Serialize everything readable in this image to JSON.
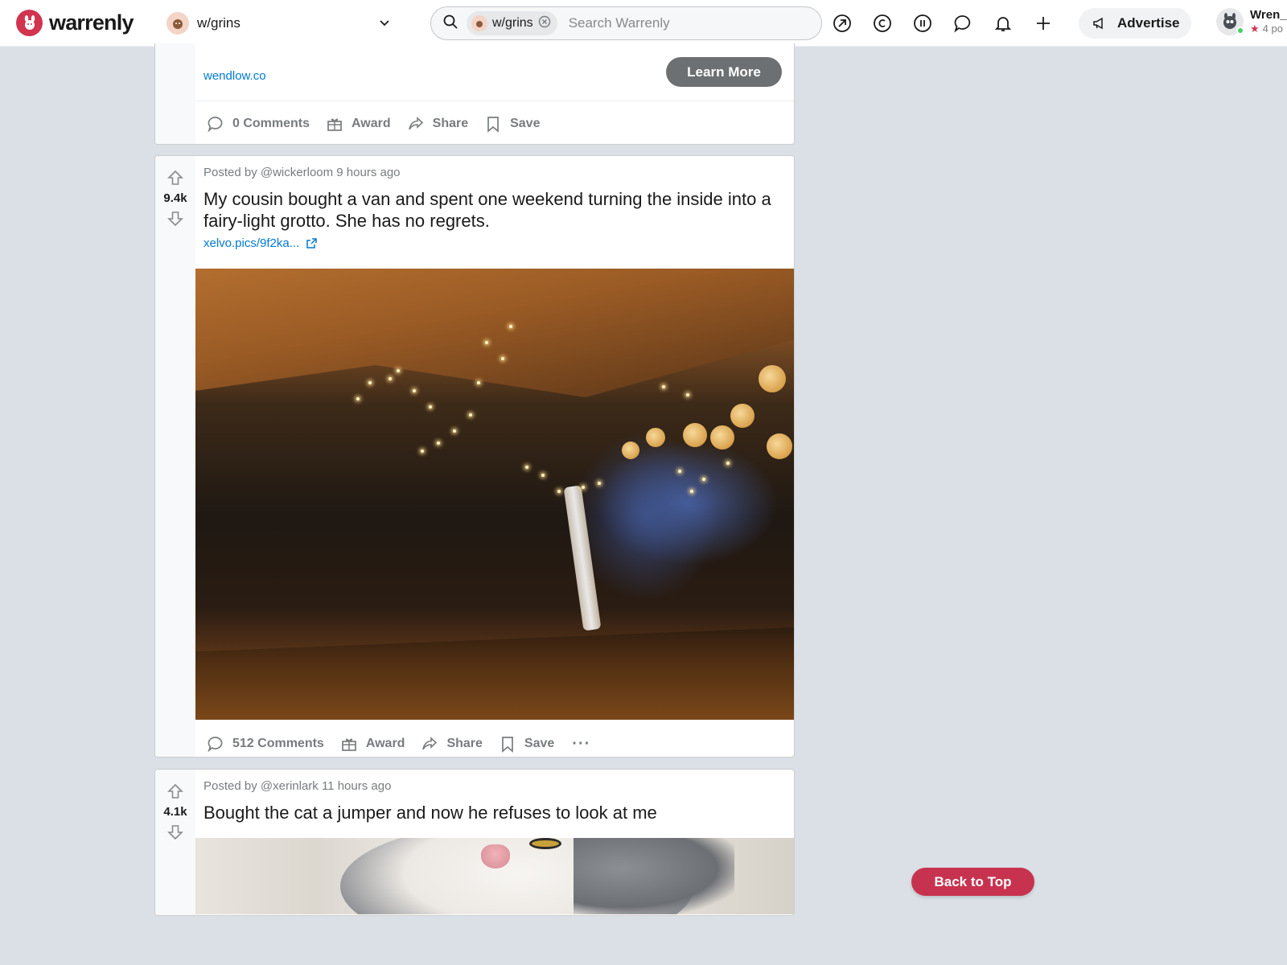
{
  "header": {
    "logo_text": "warrenly",
    "community": "w/grins",
    "search": {
      "chip": "w/grins",
      "placeholder": "Search Warrenly"
    },
    "advertise_label": "Advertise",
    "user": {
      "name": "Wren_",
      "karma": "4 po"
    }
  },
  "ad_post": {
    "domain": "wendlow.co",
    "cta": "Learn More",
    "actions": {
      "comments": "0 Comments",
      "award": "Award",
      "share": "Share",
      "save": "Save"
    }
  },
  "posts": [
    {
      "votes": "9.4k",
      "meta": "Posted by @wickerloom 9 hours ago",
      "title": "My cousin bought a van and spent one weekend turning the inside into a fairy-light grotto. She has no regrets.",
      "link": "xelvo.pics/9f2ka...",
      "actions": {
        "comments": "512 Comments",
        "award": "Award",
        "share": "Share",
        "save": "Save",
        "more": "···"
      }
    },
    {
      "votes": "4.1k",
      "meta": "Posted by @xerinlark 11 hours ago",
      "title": "Bought the cat a jumper and now he refuses to look at me"
    }
  ],
  "back_to_top": "Back to Top",
  "colors": {
    "brand": "#d1344f",
    "link": "#0079d3",
    "page_bg": "#dae0e6"
  }
}
